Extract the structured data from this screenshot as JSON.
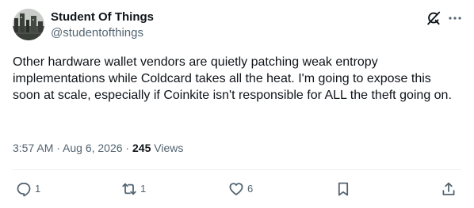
{
  "author": {
    "name": "Student Of Things",
    "handle": "@studentofthings"
  },
  "tweet": {
    "text": "Other hardware wallet vendors are quietly patching weak entropy implementations while Coldcard takes all the heat.  I'm going to expose this soon at scale, especially if Coinkite isn't responsible for ALL the theft going on.",
    "timestamp": "3:57 AM · Aug 6, 2026 · ",
    "views_count": "245",
    "views_label": " Views"
  },
  "actions": {
    "reply_count": "1",
    "repost_count": "1",
    "like_count": "6"
  },
  "icons": {
    "grok": "grok-icon",
    "more": "more-icon",
    "reply": "reply-icon",
    "repost": "repost-icon",
    "like": "like-icon",
    "bookmark": "bookmark-icon",
    "share": "share-icon"
  },
  "colors": {
    "text_primary": "#0f1419",
    "text_secondary": "#536471",
    "divider": "#eff3f4"
  }
}
